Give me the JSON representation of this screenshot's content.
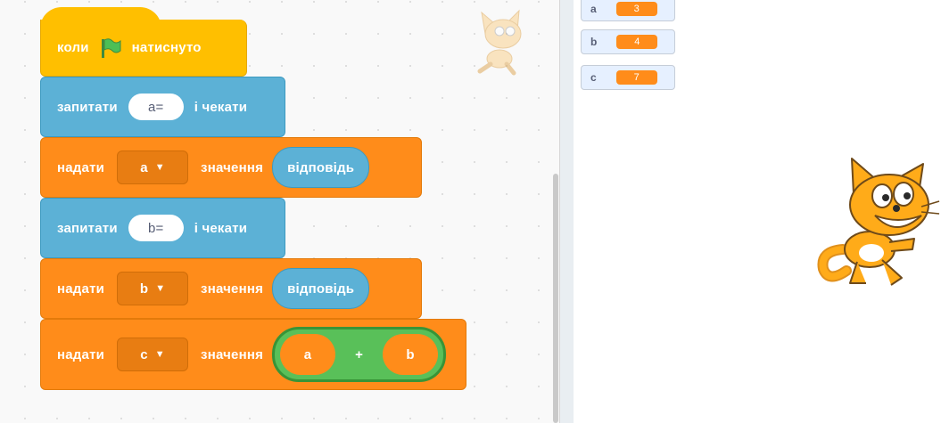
{
  "blocks": {
    "when_flag": {
      "before": "коли",
      "after": "натиснуто"
    },
    "ask_a": {
      "label": "запитати",
      "input": "a=",
      "suffix": "і чекати"
    },
    "set_a": {
      "label": "надати",
      "variable": "a",
      "mid": "значення",
      "reporter": "відповідь"
    },
    "ask_b": {
      "label": "запитати",
      "input": "b=",
      "suffix": "і чекати"
    },
    "set_b": {
      "label": "надати",
      "variable": "b",
      "mid": "значення",
      "reporter": "відповідь"
    },
    "set_c": {
      "label": "надати",
      "variable": "c",
      "mid": "значення",
      "operator": {
        "left": "a",
        "sign": "+",
        "right": "b"
      }
    }
  },
  "monitors": [
    {
      "name": "a",
      "value": "3"
    },
    {
      "name": "b",
      "value": "4"
    },
    {
      "name": "c",
      "value": "7"
    }
  ],
  "colors": {
    "events": "#ffbf00",
    "sensing": "#5cb1d6",
    "variables": "#ff8c1a",
    "operators": "#59c059"
  },
  "icons": {
    "green_flag": "green-flag-icon",
    "dropdown": "caret-down-icon",
    "sprite": "scratch-cat-sprite"
  }
}
